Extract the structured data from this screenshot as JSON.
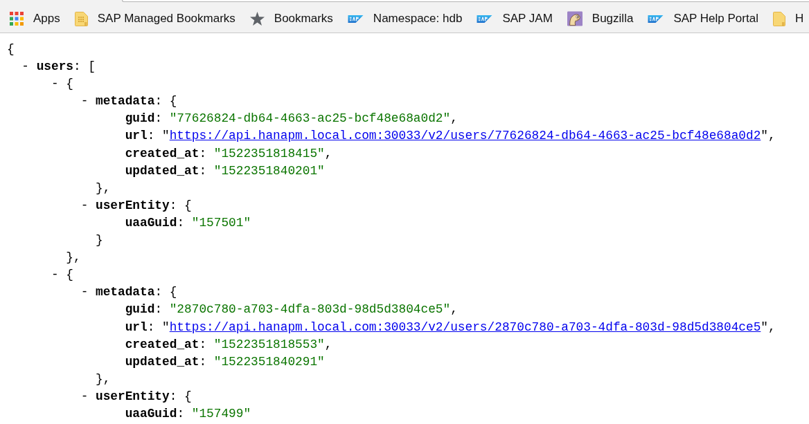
{
  "bookmarks_bar": {
    "items": [
      {
        "kind": "apps",
        "label": "Apps"
      },
      {
        "kind": "managed-folder",
        "label": "SAP Managed Bookmarks"
      },
      {
        "kind": "star",
        "label": "Bookmarks"
      },
      {
        "kind": "sap",
        "label": "Namespace: hdb"
      },
      {
        "kind": "sap",
        "label": "SAP JAM"
      },
      {
        "kind": "bugzilla",
        "label": "Bugzilla"
      },
      {
        "kind": "sap",
        "label": "SAP Help Portal"
      },
      {
        "kind": "folder",
        "label": "H"
      }
    ]
  },
  "json_view": {
    "open": "{",
    "children": [
      {
        "kind": "group",
        "toggle": "-",
        "expanded": true,
        "key": "users",
        "colon": ":",
        "open": "[",
        "children": [
          {
            "kind": "group",
            "toggle": "-",
            "expanded": true,
            "open": "{",
            "close": "},",
            "children": [
              {
                "kind": "group",
                "toggle": "-",
                "expanded": true,
                "key": "metadata",
                "colon": ":",
                "open": "{",
                "close": "},",
                "children": [
                  {
                    "kind": "string",
                    "key": "guid",
                    "colon": ":",
                    "value": "\"77626824-db64-4663-ac25-bcf48e68a0d2\"",
                    "after": ","
                  },
                  {
                    "kind": "link",
                    "key": "url",
                    "colon": ":",
                    "before": "\"",
                    "value": "https://api.hanapm.local.com:30033/v2/users/77626824-db64-4663-ac25-bcf48e68a0d2",
                    "after": "\","
                  },
                  {
                    "kind": "string",
                    "key": "created_at",
                    "colon": ":",
                    "value": "\"1522351818415\"",
                    "after": ","
                  },
                  {
                    "kind": "string",
                    "key": "updated_at",
                    "colon": ":",
                    "value": "\"1522351840201\""
                  }
                ]
              },
              {
                "kind": "group",
                "toggle": "-",
                "expanded": true,
                "key": "userEntity",
                "colon": ":",
                "open": "{",
                "close": "}",
                "children": [
                  {
                    "kind": "string",
                    "key": "uaaGuid",
                    "colon": ":",
                    "value": "\"157501\""
                  }
                ]
              }
            ]
          },
          {
            "kind": "group",
            "toggle": "-",
            "expanded": true,
            "open": "{",
            "children": [
              {
                "kind": "group",
                "toggle": "-",
                "expanded": true,
                "key": "metadata",
                "colon": ":",
                "open": "{",
                "close": "},",
                "children": [
                  {
                    "kind": "string",
                    "key": "guid",
                    "colon": ":",
                    "value": "\"2870c780-a703-4dfa-803d-98d5d3804ce5\"",
                    "after": ","
                  },
                  {
                    "kind": "link",
                    "key": "url",
                    "colon": ":",
                    "before": "\"",
                    "value": "https://api.hanapm.local.com:30033/v2/users/2870c780-a703-4dfa-803d-98d5d3804ce5",
                    "after": "\","
                  },
                  {
                    "kind": "string",
                    "key": "created_at",
                    "colon": ":",
                    "value": "\"1522351818553\"",
                    "after": ","
                  },
                  {
                    "kind": "string",
                    "key": "updated_at",
                    "colon": ":",
                    "value": "\"1522351840291\""
                  }
                ]
              },
              {
                "kind": "group",
                "toggle": "-",
                "expanded": true,
                "key": "userEntity",
                "colon": ":",
                "open": "{",
                "children": [
                  {
                    "kind": "string",
                    "key": "uaaGuid",
                    "colon": ":",
                    "value": "\"157499\""
                  }
                ]
              }
            ]
          }
        ]
      }
    ]
  }
}
